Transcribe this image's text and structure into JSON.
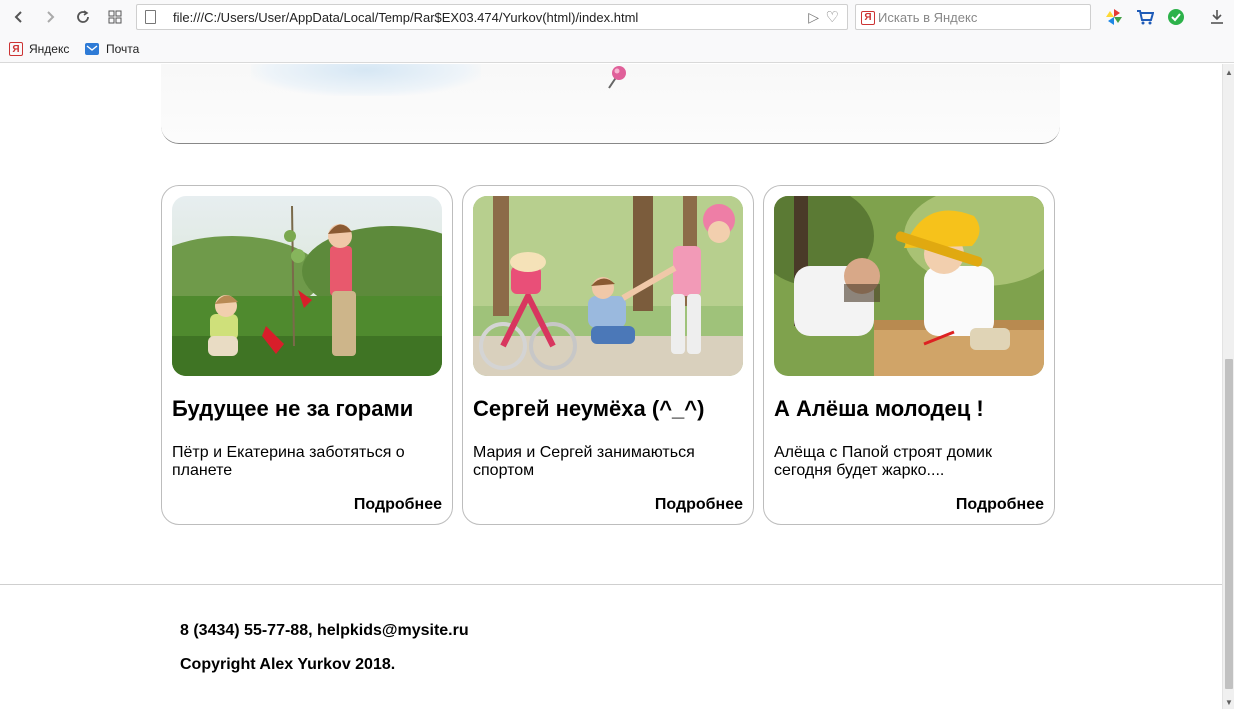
{
  "browser": {
    "url": "file:///C:/Users/User/AppData/Local/Temp/Rar$EX03.474/Yurkov(html)/index.html",
    "search_placeholder": "Искать в Яндекс",
    "search_logo": "Я",
    "bookmarks": [
      {
        "label": "Яндекс",
        "icon": "yandex-icon",
        "glyph": "Я"
      },
      {
        "label": "Почта",
        "icon": "mail-icon"
      }
    ]
  },
  "cards": [
    {
      "title": "Будущее не за горами",
      "text": "Пётр и Екатерина заботяться о планете",
      "link": "Подробнее",
      "image": "children-planting-tree"
    },
    {
      "title": "Сергей неумёха (^_^)",
      "text": "Мария и Сергей занимаються спортом",
      "link": "Подробнее",
      "image": "children-playing-with-bicycle"
    },
    {
      "title": "А Алёша молодец !",
      "text": "Алёща с Папой строят домик сегодня будет жарко....",
      "link": "Подробнее",
      "image": "father-and-son-building"
    }
  ],
  "footer": {
    "contacts": "8 (3434) 55-77-88, helpkids@mysite.ru",
    "copyright": "Copyright Alex Yurkov 2018."
  }
}
